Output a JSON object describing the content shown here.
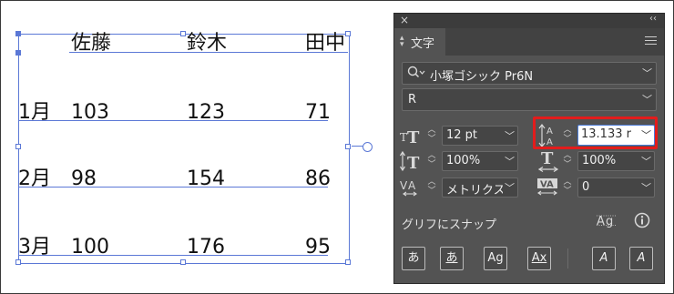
{
  "table": {
    "headers": [
      "佐藤",
      "鈴木",
      "田中"
    ],
    "rows": [
      {
        "label": "1月",
        "values": [
          "103",
          "123",
          "71"
        ]
      },
      {
        "label": "2月",
        "values": [
          "98",
          "154",
          "86"
        ]
      },
      {
        "label": "3月",
        "values": [
          "100",
          "176",
          "95"
        ]
      }
    ]
  },
  "panel": {
    "close_glyph": "×",
    "collapse_glyph": "‹‹",
    "tab_label": "文字",
    "font_family": "小塚ゴシック Pr6N",
    "font_style": "R",
    "font_size": "12 pt",
    "leading": "13.133 r",
    "vertical_scale": "100%",
    "horizontal_scale": "100%",
    "kerning": "メトリクス",
    "tracking": "0",
    "snap_to_glyph_label": "グリフにスナップ",
    "colors": {
      "panel_bg": "#535353",
      "selection_blue": "#5b78d6",
      "highlight_red": "#e21c1c"
    }
  },
  "icons": {
    "search": "search-icon",
    "font_size": "font-size-icon",
    "leading": "leading-icon",
    "vertical_scale": "vertical-scale-icon",
    "horizontal_scale": "horizontal-scale-icon",
    "kerning": "kerning-icon",
    "tracking": "tracking-icon",
    "glyph_snap": "glyph-snap-icon",
    "info": "info-icon"
  },
  "bottom_buttons": [
    "あ",
    "あ",
    "Ag",
    "Ax",
    "A",
    "A"
  ]
}
